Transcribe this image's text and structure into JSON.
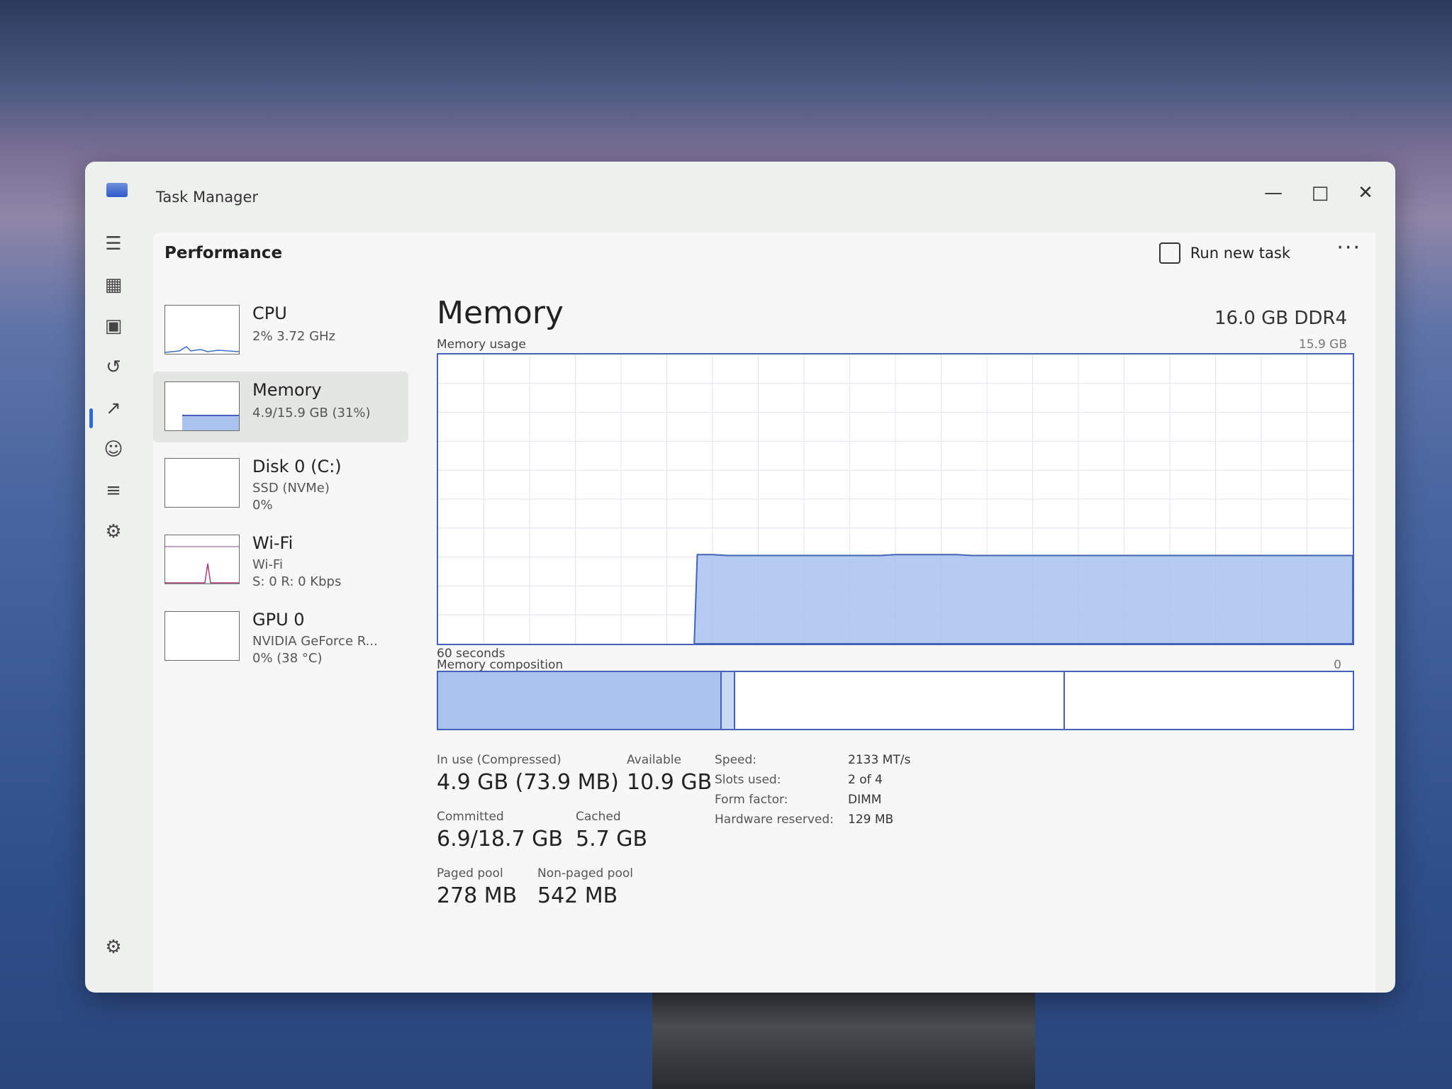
{
  "window": {
    "title": "Task Manager"
  },
  "header": {
    "page_title": "Performance",
    "run_new_task": "Run new task"
  },
  "sidebar": {
    "items": [
      {
        "name": "CPU",
        "line1": "2% 3.72 GHz",
        "line2": ""
      },
      {
        "name": "Memory",
        "line1": "4.9/15.9 GB (31%)",
        "line2": ""
      },
      {
        "name": "Disk 0 (C:)",
        "line1": "SSD (NVMe)",
        "line2": "0%"
      },
      {
        "name": "Wi-Fi",
        "line1": "Wi-Fi",
        "line2": "S: 0 R: 0 Kbps"
      },
      {
        "name": "GPU 0",
        "line1": "NVIDIA GeForce R...",
        "line2": "0% (38 °C)"
      }
    ]
  },
  "main": {
    "title": "Memory",
    "spec": "16.0 GB DDR4",
    "usage_label": "Memory usage",
    "usage_max": "15.9 GB",
    "time_label": "60 seconds",
    "zero_label": "0",
    "composition_label": "Memory composition",
    "composition": {
      "in_use": 0.31,
      "modified": 0.015,
      "standby": 0.36,
      "free": 0.315
    }
  },
  "stats": {
    "in_use_label": "In use (Compressed)",
    "in_use_value": "4.9 GB (73.9 MB)",
    "available_label": "Available",
    "available_value": "10.9 GB",
    "committed_label": "Committed",
    "committed_value": "6.9/18.7 GB",
    "cached_label": "Cached",
    "cached_value": "5.7 GB",
    "paged_label": "Paged pool",
    "paged_value": "278 MB",
    "nonpaged_label": "Non-paged pool",
    "nonpaged_value": "542 MB"
  },
  "hardware": {
    "speed_label": "Speed:",
    "speed_value": "2133 MT/s",
    "slots_label": "Slots used:",
    "slots_value": "2 of 4",
    "form_label": "Form factor:",
    "form_value": "DIMM",
    "reserved_label": "Hardware reserved:",
    "reserved_value": "129 MB"
  },
  "usage_series": {
    "max_gb": 15.9,
    "values_gb": [
      0,
      0,
      0,
      0,
      0,
      0,
      0,
      0,
      0,
      0,
      0,
      0,
      0,
      0,
      0,
      0,
      0,
      4.9,
      4.9,
      4.85,
      4.85,
      4.85,
      4.85,
      4.85,
      4.85,
      4.85,
      4.85,
      4.85,
      4.85,
      4.85,
      4.9,
      4.9,
      4.9,
      4.9,
      4.9,
      4.85,
      4.85,
      4.85,
      4.85,
      4.85,
      4.85,
      4.85,
      4.85,
      4.85,
      4.85,
      4.85,
      4.85,
      4.85,
      4.85,
      4.85,
      4.85,
      4.85,
      4.85,
      4.85,
      4.85,
      4.85,
      4.85,
      4.85,
      4.85,
      4.85,
      4.85
    ]
  },
  "colors": {
    "accent": "#4463b8",
    "fill": "#a9c2ee"
  }
}
